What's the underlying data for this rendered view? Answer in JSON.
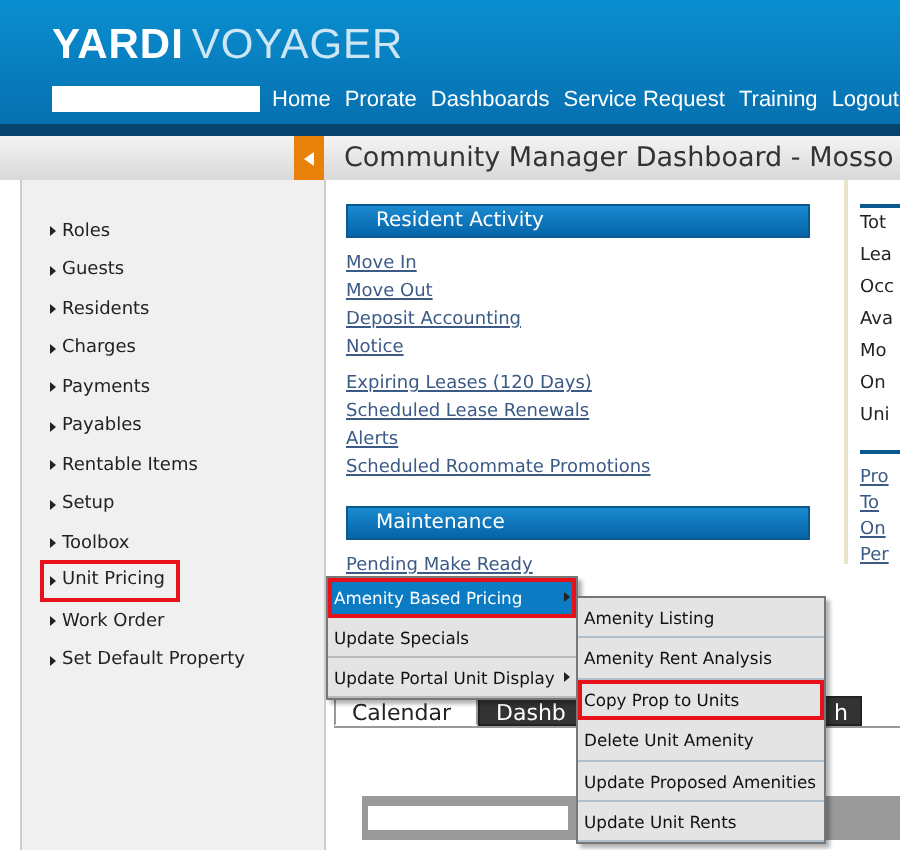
{
  "app": {
    "logo_bold": "YARDI",
    "logo_light": "VOYAGER"
  },
  "nav": [
    "Home",
    "Prorate",
    "Dashboards",
    "Service Request",
    "Training",
    "Logout"
  ],
  "page_title": "Community Manager Dashboard - Mosso",
  "sidebar": {
    "items": [
      {
        "label": "Roles",
        "highlighted": false
      },
      {
        "label": "Guests",
        "highlighted": false
      },
      {
        "label": "Residents",
        "highlighted": false
      },
      {
        "label": "Charges",
        "highlighted": false
      },
      {
        "label": "Payments",
        "highlighted": false
      },
      {
        "label": "Payables",
        "highlighted": false
      },
      {
        "label": "Rentable Items",
        "highlighted": false
      },
      {
        "label": "Setup",
        "highlighted": false
      },
      {
        "label": "Toolbox",
        "highlighted": false
      },
      {
        "label": "Unit Pricing",
        "highlighted": true
      },
      {
        "label": "Work Order",
        "highlighted": false
      },
      {
        "label": "Set Default Property",
        "highlighted": false
      }
    ]
  },
  "sections": [
    {
      "title": "Resident Activity",
      "groups": [
        [
          "Move In",
          "Move Out",
          "Deposit Accounting",
          "Notice"
        ],
        [
          "Expiring Leases (120 Days)",
          "Scheduled Lease Renewals",
          "Alerts",
          "Scheduled Roommate Promotions"
        ]
      ]
    },
    {
      "title": "Maintenance",
      "groups": [
        [
          "Pending Make Ready"
        ]
      ]
    }
  ],
  "right_column": {
    "stats": [
      "Tot",
      "Lea",
      "Occ",
      "Ava",
      "Mo",
      "On",
      "Uni"
    ],
    "links": [
      "Pro",
      "To",
      "On",
      "Per"
    ]
  },
  "tabs": [
    {
      "label": "Calendar",
      "selected": true
    },
    {
      "label": "Dashb",
      "selected": false
    },
    {
      "label": "h",
      "selected": false
    }
  ],
  "menu": [
    {
      "label": "Amenity Based Pricing",
      "selected": true,
      "highlighted": true,
      "has_submenu": true
    },
    {
      "label": "Update Specials",
      "selected": false,
      "highlighted": false,
      "has_submenu": false
    },
    {
      "label": "Update Portal Unit Display",
      "selected": false,
      "highlighted": false,
      "has_submenu": true
    }
  ],
  "submenu": [
    {
      "label": "Amenity Listing",
      "highlighted": false
    },
    {
      "label": "Amenity Rent Analysis",
      "highlighted": false
    },
    {
      "label": "Copy Prop to Units",
      "highlighted": true
    },
    {
      "label": "Delete Unit Amenity",
      "highlighted": false
    },
    {
      "label": "Update Proposed Amenities",
      "highlighted": false
    },
    {
      "label": "Update Unit Rents",
      "highlighted": false
    }
  ]
}
